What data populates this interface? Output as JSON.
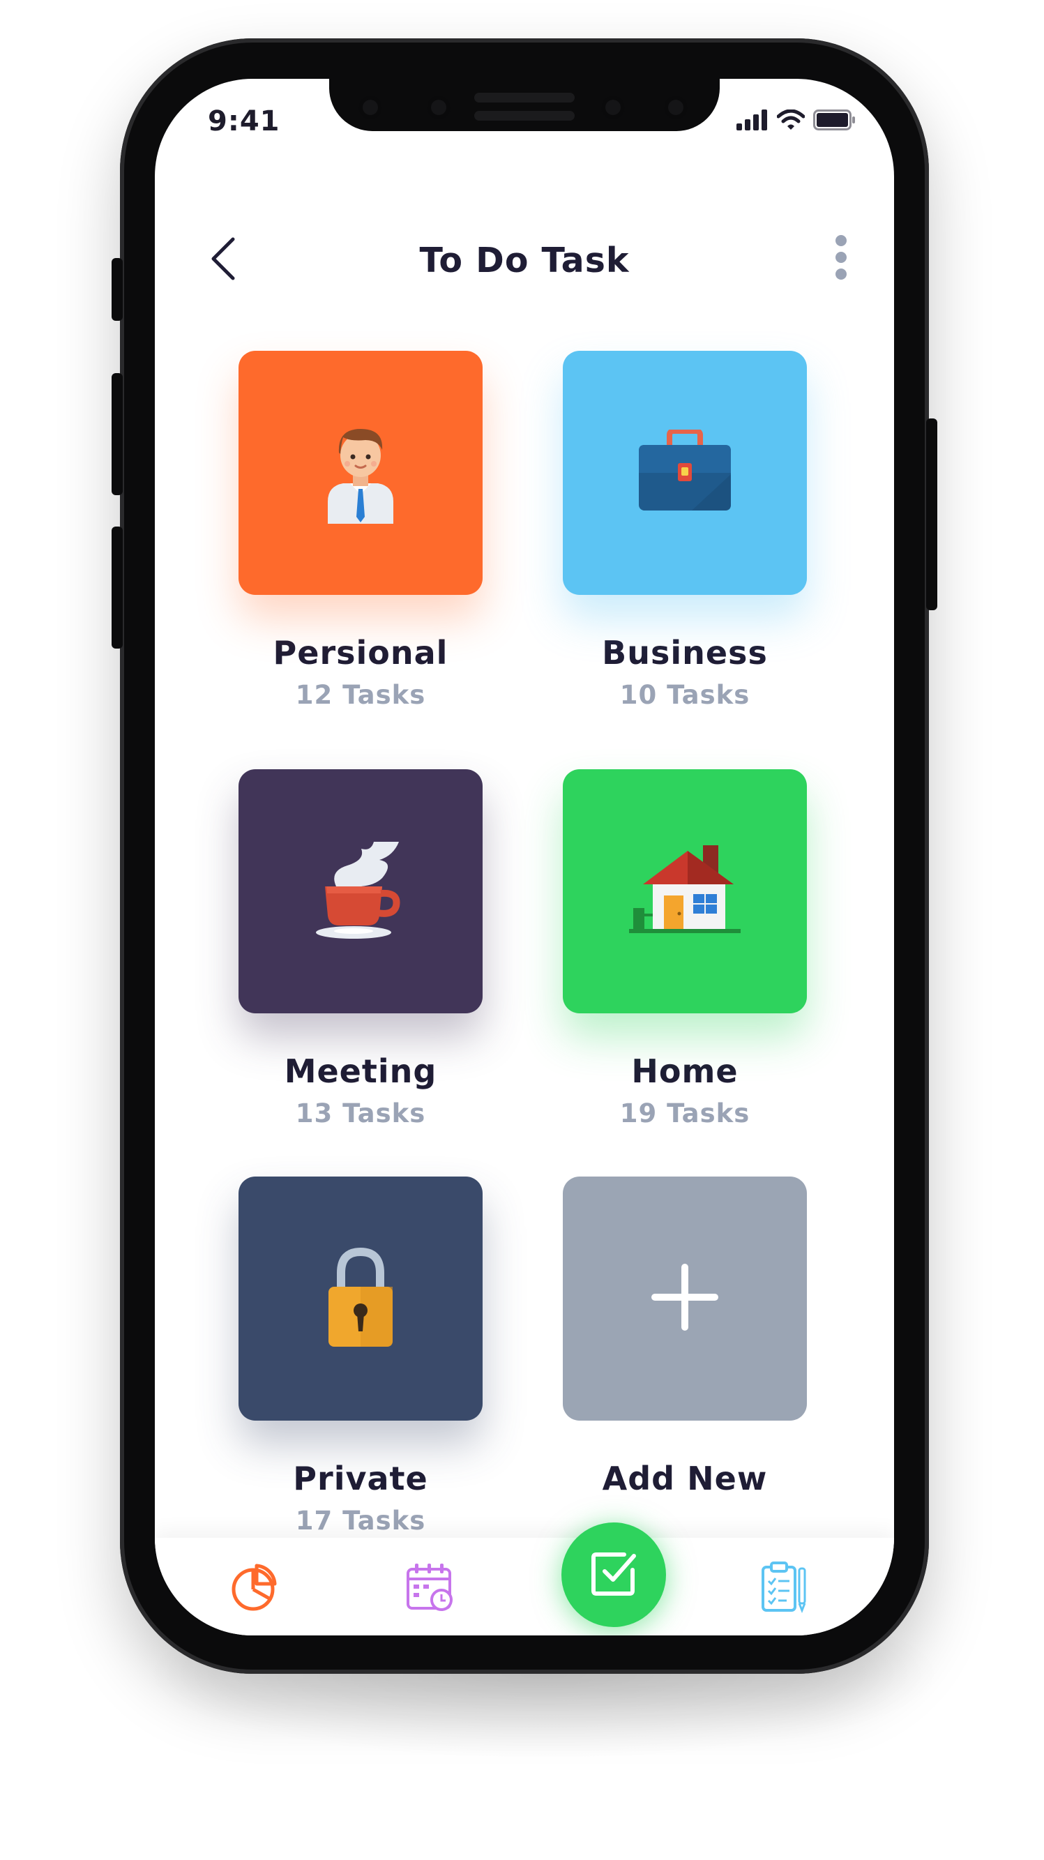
{
  "status_bar": {
    "time": "9:41",
    "icons": [
      "signal-icon",
      "wifi-icon",
      "battery-icon"
    ]
  },
  "header": {
    "title": "To Do Task",
    "back_icon": "chevron-left-icon",
    "menu_icon": "more-vertical-icon"
  },
  "categories": [
    {
      "title": "Persional",
      "subtitle": "12 Tasks",
      "color": "#fe6a2c",
      "icon": "businessman-icon"
    },
    {
      "title": "Business",
      "subtitle": "10 Tasks",
      "color": "#5cc4f3",
      "icon": "briefcase-icon"
    },
    {
      "title": "Meeting",
      "subtitle": "13 Tasks",
      "color": "#413558",
      "icon": "coffee-cup-icon"
    },
    {
      "title": "Home",
      "subtitle": "19 Tasks",
      "color": "#2ed35d",
      "icon": "house-icon"
    },
    {
      "title": "Private",
      "subtitle": "17 Tasks",
      "color": "#3a4a6a",
      "icon": "padlock-icon"
    },
    {
      "title": "Add New",
      "subtitle": "",
      "color": "#9ba5b4",
      "icon": "plus-icon"
    }
  ],
  "bottom_nav": {
    "items": [
      {
        "icon": "pie-chart-icon",
        "color": "#fe6a2c"
      },
      {
        "icon": "calendar-icon",
        "color": "#c775ec"
      },
      {
        "icon": "checklist-icon",
        "color": "#5cc4f3"
      }
    ],
    "fab": {
      "icon": "checkbox-icon",
      "color": "#2ed35d"
    }
  }
}
